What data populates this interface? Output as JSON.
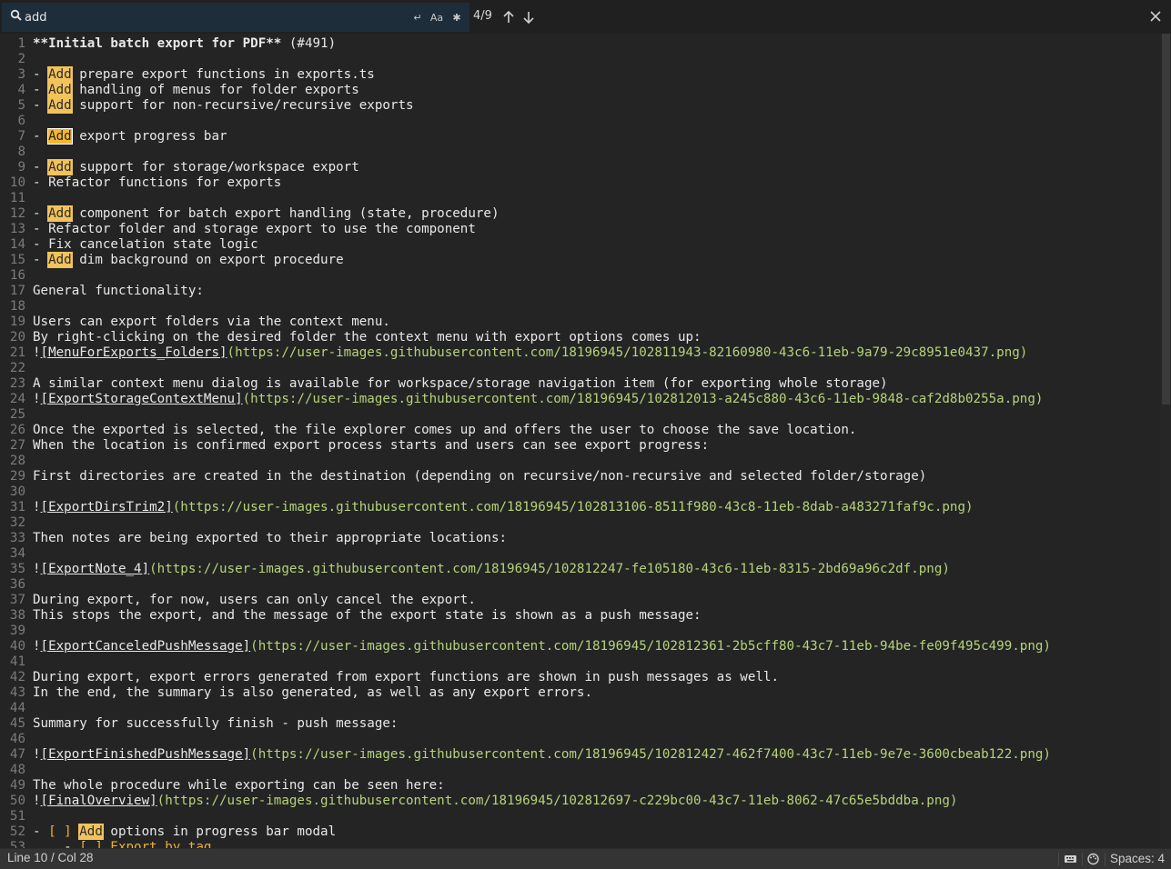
{
  "find": {
    "query": "add",
    "match_count": "4/9",
    "options": [
      {
        "name": "wrap-icon",
        "glyph": "↵"
      },
      {
        "name": "match-case-icon",
        "glyph": "Aa"
      },
      {
        "name": "regex-icon",
        "glyph": "✱"
      }
    ]
  },
  "editor": {
    "lines": [
      {
        "n": "1",
        "s": [
          {
            "t": "**Initial batch export for PDF**",
            "c": "bold"
          },
          {
            "t": " (#491)"
          }
        ]
      },
      {
        "n": "2",
        "s": []
      },
      {
        "n": "3",
        "s": [
          {
            "t": "- "
          },
          {
            "t": "Add",
            "c": "hl"
          },
          {
            "t": " prepare export functions in exports.ts"
          }
        ]
      },
      {
        "n": "4",
        "s": [
          {
            "t": "- "
          },
          {
            "t": "Add",
            "c": "hl"
          },
          {
            "t": " handling of menus for folder exports"
          }
        ]
      },
      {
        "n": "5",
        "s": [
          {
            "t": "- "
          },
          {
            "t": "Add",
            "c": "hl"
          },
          {
            "t": " support for non-recursive/recursive exports"
          }
        ]
      },
      {
        "n": "6",
        "s": []
      },
      {
        "n": "7",
        "s": [
          {
            "t": "- "
          },
          {
            "t": "Add",
            "c": "hl cur"
          },
          {
            "t": " export progress bar"
          }
        ]
      },
      {
        "n": "8",
        "s": []
      },
      {
        "n": "9",
        "s": [
          {
            "t": "- "
          },
          {
            "t": "Add",
            "c": "hl"
          },
          {
            "t": " support for storage/workspace export"
          }
        ]
      },
      {
        "n": "10",
        "s": [
          {
            "t": "- Refactor functions for exports"
          }
        ]
      },
      {
        "n": "11",
        "s": []
      },
      {
        "n": "12",
        "s": [
          {
            "t": "- "
          },
          {
            "t": "Add",
            "c": "hl"
          },
          {
            "t": " component for batch export handling (state, procedure)"
          }
        ]
      },
      {
        "n": "13",
        "s": [
          {
            "t": "- Refactor folder and storage export to use the component"
          }
        ]
      },
      {
        "n": "14",
        "s": [
          {
            "t": "- Fix cancelation state logic"
          }
        ]
      },
      {
        "n": "15",
        "s": [
          {
            "t": "- "
          },
          {
            "t": "Add",
            "c": "hl"
          },
          {
            "t": " dim background on export procedure"
          }
        ]
      },
      {
        "n": "16",
        "s": []
      },
      {
        "n": "17",
        "s": [
          {
            "t": "General functionality:"
          }
        ]
      },
      {
        "n": "18",
        "s": []
      },
      {
        "n": "19",
        "s": [
          {
            "t": "Users can export folders via the context menu."
          }
        ]
      },
      {
        "n": "20",
        "s": [
          {
            "t": "By right-clicking on the desired folder the context menu with export options comes up:"
          }
        ]
      },
      {
        "n": "21",
        "s": [
          {
            "t": "!"
          },
          {
            "t": "[MenuForExports_Folders]",
            "c": "link-text"
          },
          {
            "t": "(https://user-images.githubusercontent.com/18196945/102811943-82160980-43c6-11eb-9a79-29c8951e0437.png)",
            "c": "url"
          }
        ]
      },
      {
        "n": "22",
        "s": []
      },
      {
        "n": "23",
        "s": [
          {
            "t": "A similar context menu dialog is available for workspace/storage navigation item (for exporting whole storage)"
          }
        ]
      },
      {
        "n": "24",
        "s": [
          {
            "t": "!"
          },
          {
            "t": "[ExportStorageContextMenu]",
            "c": "link-text"
          },
          {
            "t": "(https://user-images.githubusercontent.com/18196945/102812013-a245c880-43c6-11eb-9848-caf2d8b0255a.png)",
            "c": "url"
          }
        ]
      },
      {
        "n": "25",
        "s": []
      },
      {
        "n": "26",
        "s": [
          {
            "t": "Once the exported is selected, the file explorer comes up and offers the user to choose the save location."
          }
        ]
      },
      {
        "n": "27",
        "s": [
          {
            "t": "When the location is confirmed export process starts and users can see export progress:"
          }
        ]
      },
      {
        "n": "28",
        "s": []
      },
      {
        "n": "29",
        "s": [
          {
            "t": "First directories are created in the destination (depending on recursive/non-recursive and selected folder/storage)"
          }
        ]
      },
      {
        "n": "30",
        "s": []
      },
      {
        "n": "31",
        "s": [
          {
            "t": "!"
          },
          {
            "t": "[ExportDirsTrim2]",
            "c": "link-text"
          },
          {
            "t": "(https://user-images.githubusercontent.com/18196945/102813106-8511f980-43c8-11eb-8dab-a483271faf9c.png)",
            "c": "url"
          }
        ]
      },
      {
        "n": "32",
        "s": []
      },
      {
        "n": "33",
        "s": [
          {
            "t": "Then notes are being exported to their appropriate locations:"
          }
        ]
      },
      {
        "n": "34",
        "s": []
      },
      {
        "n": "35",
        "s": [
          {
            "t": "!"
          },
          {
            "t": "[ExportNote_4]",
            "c": "link-text"
          },
          {
            "t": "(https://user-images.githubusercontent.com/18196945/102812247-fe105180-43c6-11eb-8315-2bd69a96c2df.png)",
            "c": "url"
          }
        ]
      },
      {
        "n": "36",
        "s": []
      },
      {
        "n": "37",
        "s": [
          {
            "t": "During export, for now, users can only cancel the export."
          }
        ]
      },
      {
        "n": "38",
        "s": [
          {
            "t": "This stops the export, and the message of the export state is shown as a push message:"
          }
        ]
      },
      {
        "n": "39",
        "s": []
      },
      {
        "n": "40",
        "s": [
          {
            "t": "!"
          },
          {
            "t": "[ExportCanceledPushMessage]",
            "c": "link-text"
          },
          {
            "t": "(https://user-images.githubusercontent.com/18196945/102812361-2b5cff80-43c7-11eb-94be-fe09f495c499.png)",
            "c": "url"
          }
        ]
      },
      {
        "n": "41",
        "s": []
      },
      {
        "n": "42",
        "s": [
          {
            "t": "During export, export errors generated from export functions are shown in push messages as well."
          }
        ]
      },
      {
        "n": "43",
        "s": [
          {
            "t": "In the end, the summary is also generated, as well as any export errors."
          }
        ]
      },
      {
        "n": "44",
        "s": []
      },
      {
        "n": "45",
        "s": [
          {
            "t": "Summary for successfully finish - push message:"
          }
        ]
      },
      {
        "n": "46",
        "s": []
      },
      {
        "n": "47",
        "s": [
          {
            "t": "!"
          },
          {
            "t": "[ExportFinishedPushMessage]",
            "c": "link-text"
          },
          {
            "t": "(https://user-images.githubusercontent.com/18196945/102812427-462f7400-43c7-11eb-9e7e-3600cbeab122.png)",
            "c": "url"
          }
        ]
      },
      {
        "n": "48",
        "s": []
      },
      {
        "n": "49",
        "s": [
          {
            "t": "The whole procedure while exporting can be seen here:"
          }
        ]
      },
      {
        "n": "50",
        "s": [
          {
            "t": "!"
          },
          {
            "t": "[FinalOverview]",
            "c": "link-text"
          },
          {
            "t": "(https://user-images.githubusercontent.com/18196945/102812697-c229bc00-43c7-11eb-8062-47c65e5bddba.png)",
            "c": "url"
          }
        ]
      },
      {
        "n": "51",
        "s": []
      },
      {
        "n": "52",
        "s": [
          {
            "t": "- "
          },
          {
            "t": "[ ]",
            "c": "chk"
          },
          {
            "t": " "
          },
          {
            "t": "Add",
            "c": "hl"
          },
          {
            "t": " options in progress bar modal"
          }
        ]
      },
      {
        "n": "53",
        "s": [
          {
            "t": "    - "
          },
          {
            "t": "[ ]",
            "c": "chk"
          },
          {
            "t": " "
          },
          {
            "t": "Export by tag",
            "c": "tag"
          }
        ]
      }
    ]
  },
  "status": {
    "position": "Line 10 / Col 28",
    "indent": "Spaces: 4",
    "icons": [
      "keyboard-icon",
      "palette-icon"
    ]
  }
}
